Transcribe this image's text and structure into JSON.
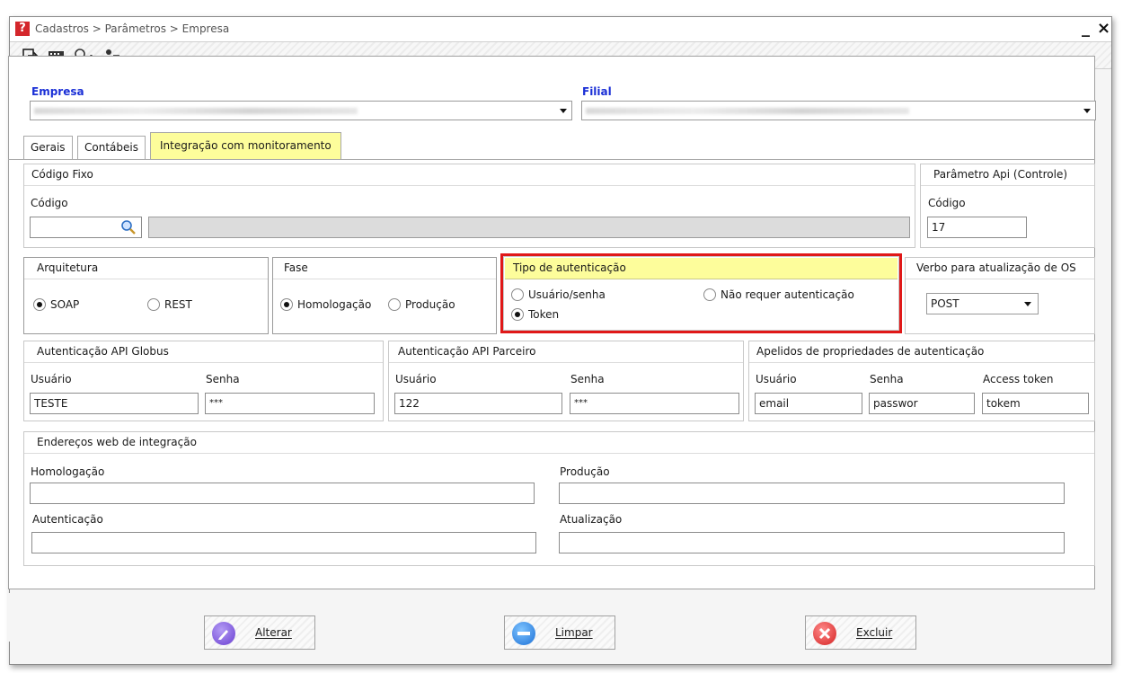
{
  "window": {
    "title": "Cadastros > Parâmetros > Empresa",
    "minimize": "_",
    "close": "×"
  },
  "toolbar": {
    "icons": [
      "exit-icon",
      "keyboard-icon",
      "search-icon",
      "users-icon"
    ]
  },
  "header": {
    "empresa_label": "Empresa",
    "filial_label": "Filial"
  },
  "tabs": [
    {
      "label": "Gerais"
    },
    {
      "label": "Contábeis"
    },
    {
      "label": "Integração com monitoramento"
    }
  ],
  "codigo_fixo": {
    "title": "Código Fixo",
    "codigo_label": "Código",
    "codigo_value": ""
  },
  "parametro_api": {
    "title": "Parâmetro Api (Controle)",
    "codigo_label": "Código",
    "codigo_value": "17"
  },
  "arquitetura": {
    "title": "Arquitetura",
    "options": [
      "SOAP",
      "REST"
    ],
    "selected": "SOAP"
  },
  "fase": {
    "title": "Fase",
    "options": [
      "Homologação",
      "Produção"
    ],
    "selected": "Homologação"
  },
  "tipo_autenticacao": {
    "title": "Tipo de autenticação",
    "options": [
      "Usuário/senha",
      "Não requer autenticação",
      "Token"
    ],
    "selected": "Token"
  },
  "verbo": {
    "title": "Verbo para atualização de OS",
    "value": "POST"
  },
  "auth_globus": {
    "title": "Autenticação API Globus",
    "usuario_label": "Usuário",
    "senha_label": "Senha",
    "usuario_value": "TESTE",
    "senha_value": "***"
  },
  "auth_parceiro": {
    "title": "Autenticação API Parceiro",
    "usuario_label": "Usuário",
    "senha_label": "Senha",
    "usuario_value": "122",
    "senha_value": "***"
  },
  "apelidos": {
    "title": "Apelidos de propriedades de autenticação",
    "usuario_label": "Usuário",
    "senha_label": "Senha",
    "token_label": "Access token",
    "usuario_value": "email",
    "senha_value": "passwor",
    "token_value": "tokem"
  },
  "enderecos": {
    "title": "Endereços web de integração",
    "homologacao_label": "Homologação",
    "producao_label": "Produção",
    "autenticacao_label": "Autenticação",
    "atualizacao_label": "Atualização",
    "homologacao_value": "",
    "producao_value": "",
    "autenticacao_value": "",
    "atualizacao_value": ""
  },
  "footer": {
    "alterar": "Alterar",
    "limpar": "Limpar",
    "excluir": "Excluir"
  },
  "colors": {
    "accent_yellow": "#fdfd9b",
    "label_blue": "#1a2fd6",
    "highlight_red": "#e01818"
  }
}
